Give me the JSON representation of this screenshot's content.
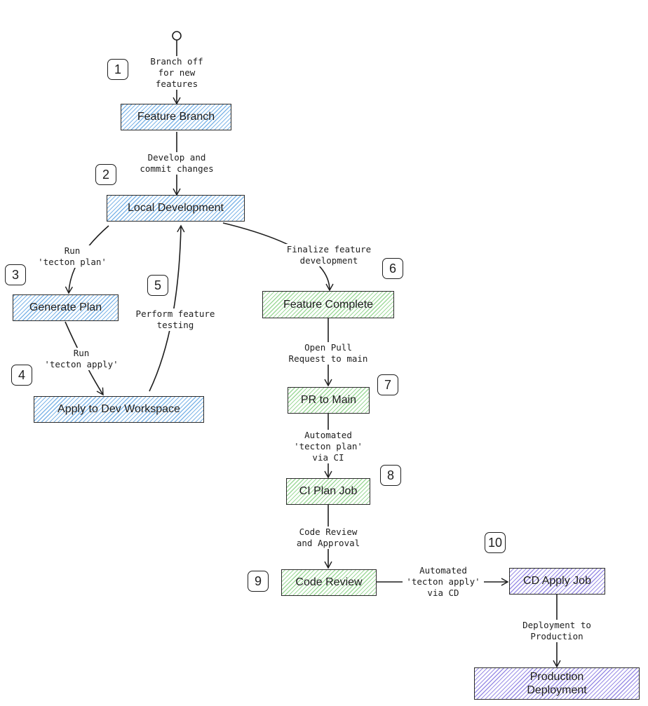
{
  "diagram": {
    "nodes": [
      {
        "id": "feature-branch",
        "label": "Feature Branch",
        "color": "blue"
      },
      {
        "id": "local-development",
        "label": "Local Development",
        "color": "blue"
      },
      {
        "id": "generate-plan",
        "label": "Generate Plan",
        "color": "blue"
      },
      {
        "id": "apply-to-dev-workspace",
        "label": "Apply to Dev Workspace",
        "color": "blue"
      },
      {
        "id": "feature-complete",
        "label": "Feature Complete",
        "color": "green"
      },
      {
        "id": "pr-to-main",
        "label": "PR to Main",
        "color": "green"
      },
      {
        "id": "ci-plan-job",
        "label": "CI Plan Job",
        "color": "green"
      },
      {
        "id": "code-review",
        "label": "Code Review",
        "color": "green"
      },
      {
        "id": "cd-apply-job",
        "label": "CD Apply Job",
        "color": "purple"
      },
      {
        "id": "production-deployment",
        "label": "Production\nDeployment",
        "color": "purple"
      }
    ],
    "edges": [
      {
        "from": "start",
        "to": "feature-branch",
        "label": "Branch off\nfor new\nfeatures"
      },
      {
        "from": "feature-branch",
        "to": "local-development",
        "label": "Develop and\ncommit changes"
      },
      {
        "from": "local-development",
        "to": "generate-plan",
        "label": "Run\n'tecton plan'"
      },
      {
        "from": "generate-plan",
        "to": "apply-to-dev-workspace",
        "label": "Run\n'tecton apply'"
      },
      {
        "from": "apply-to-dev-workspace",
        "to": "local-development",
        "label": "Perform feature\ntesting"
      },
      {
        "from": "local-development",
        "to": "feature-complete",
        "label": "Finalize feature\ndevelopment"
      },
      {
        "from": "feature-complete",
        "to": "pr-to-main",
        "label": "Open Pull\nRequest to main"
      },
      {
        "from": "pr-to-main",
        "to": "ci-plan-job",
        "label": "Automated\n'tecton plan'\nvia CI"
      },
      {
        "from": "ci-plan-job",
        "to": "code-review",
        "label": "Code Review\nand Approval"
      },
      {
        "from": "code-review",
        "to": "cd-apply-job",
        "label": "Automated\n'tecton apply'\nvia CD"
      },
      {
        "from": "cd-apply-job",
        "to": "production-deployment",
        "label": "Deployment to\nProduction"
      }
    ],
    "step_badges": [
      "1",
      "2",
      "3",
      "4",
      "5",
      "6",
      "7",
      "8",
      "9",
      "10"
    ],
    "colors": {
      "blue": "#7fb6e8",
      "green": "#9ed99a",
      "purple": "#9b8fe6",
      "stroke": "#1e1e1e"
    }
  }
}
